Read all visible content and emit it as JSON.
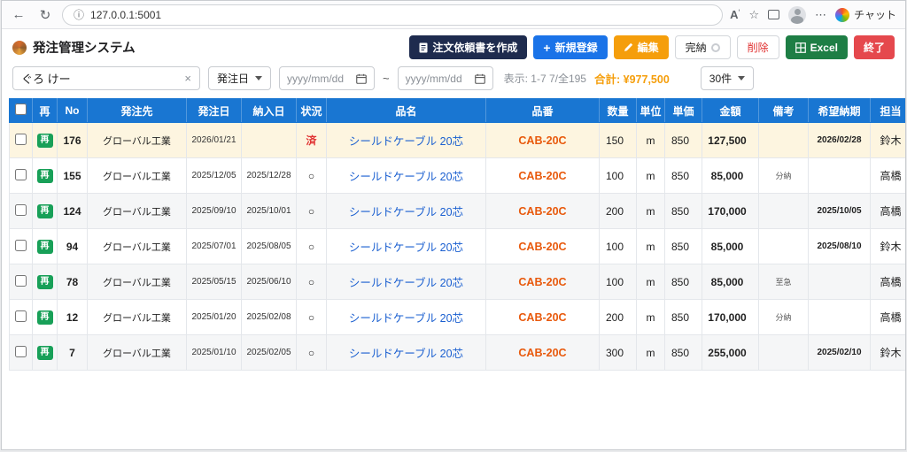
{
  "browser": {
    "url": "127.0.0.1:5001",
    "chat_label": "チャット"
  },
  "app": {
    "title": "発注管理システム"
  },
  "toolbar": {
    "create_doc": "注文依頼書を作成",
    "add_plus": "+",
    "add": "新規登録",
    "edit": "編集",
    "complete": "完納",
    "delete": "削除",
    "excel": "Excel",
    "exit": "終了"
  },
  "filter": {
    "search_value": "ぐろ けー",
    "clear": "×",
    "sort_field": "発注日",
    "date_from": "yyyy/mm/dd",
    "date_to": "yyyy/mm/dd",
    "range_separator": "~",
    "display_info": "表示: 1-7 7/全195",
    "total_label": "合計: ¥977,500",
    "page_size": "30件"
  },
  "table": {
    "re_badge": "再",
    "headers": [
      "再",
      "No",
      "発注先",
      "発注日",
      "納入日",
      "状況",
      "品名",
      "品番",
      "数量",
      "単位",
      "単価",
      "金額",
      "備考",
      "希望納期",
      "担当"
    ],
    "rows": [
      {
        "no": "176",
        "supplier": "グローバル工業",
        "order_date": "2026/01/21",
        "delivery_date": "",
        "status": "済",
        "product": "シールドケーブル 20芯",
        "part": "CAB-20C",
        "qty": "150",
        "unit": "m",
        "price": "850",
        "amount": "127,500",
        "note": "",
        "desired": "2026/02/28",
        "person": "鈴木",
        "highlight": true
      },
      {
        "no": "155",
        "supplier": "グローバル工業",
        "order_date": "2025/12/05",
        "delivery_date": "2025/12/28",
        "status": "○",
        "product": "シールドケーブル 20芯",
        "part": "CAB-20C",
        "qty": "100",
        "unit": "m",
        "price": "850",
        "amount": "85,000",
        "note": "分納",
        "desired": "",
        "person": "高橋",
        "highlight": false
      },
      {
        "no": "124",
        "supplier": "グローバル工業",
        "order_date": "2025/09/10",
        "delivery_date": "2025/10/01",
        "status": "○",
        "product": "シールドケーブル 20芯",
        "part": "CAB-20C",
        "qty": "200",
        "unit": "m",
        "price": "850",
        "amount": "170,000",
        "note": "",
        "desired": "2025/10/05",
        "person": "高橋",
        "highlight": false
      },
      {
        "no": "94",
        "supplier": "グローバル工業",
        "order_date": "2025/07/01",
        "delivery_date": "2025/08/05",
        "status": "○",
        "product": "シールドケーブル 20芯",
        "part": "CAB-20C",
        "qty": "100",
        "unit": "m",
        "price": "850",
        "amount": "85,000",
        "note": "",
        "desired": "2025/08/10",
        "person": "鈴木",
        "highlight": false
      },
      {
        "no": "78",
        "supplier": "グローバル工業",
        "order_date": "2025/05/15",
        "delivery_date": "2025/06/10",
        "status": "○",
        "product": "シールドケーブル 20芯",
        "part": "CAB-20C",
        "qty": "100",
        "unit": "m",
        "price": "850",
        "amount": "85,000",
        "note": "至急",
        "desired": "",
        "person": "高橋",
        "highlight": false
      },
      {
        "no": "12",
        "supplier": "グローバル工業",
        "order_date": "2025/01/20",
        "delivery_date": "2025/02/08",
        "status": "○",
        "product": "シールドケーブル 20芯",
        "part": "CAB-20C",
        "qty": "200",
        "unit": "m",
        "price": "850",
        "amount": "170,000",
        "note": "分納",
        "desired": "",
        "person": "高橋",
        "highlight": false
      },
      {
        "no": "7",
        "supplier": "グローバル工業",
        "order_date": "2025/01/10",
        "delivery_date": "2025/02/05",
        "status": "○",
        "product": "シールドケーブル 20芯",
        "part": "CAB-20C",
        "qty": "300",
        "unit": "m",
        "price": "850",
        "amount": "255,000",
        "note": "",
        "desired": "2025/02/10",
        "person": "鈴木",
        "highlight": false
      }
    ]
  }
}
